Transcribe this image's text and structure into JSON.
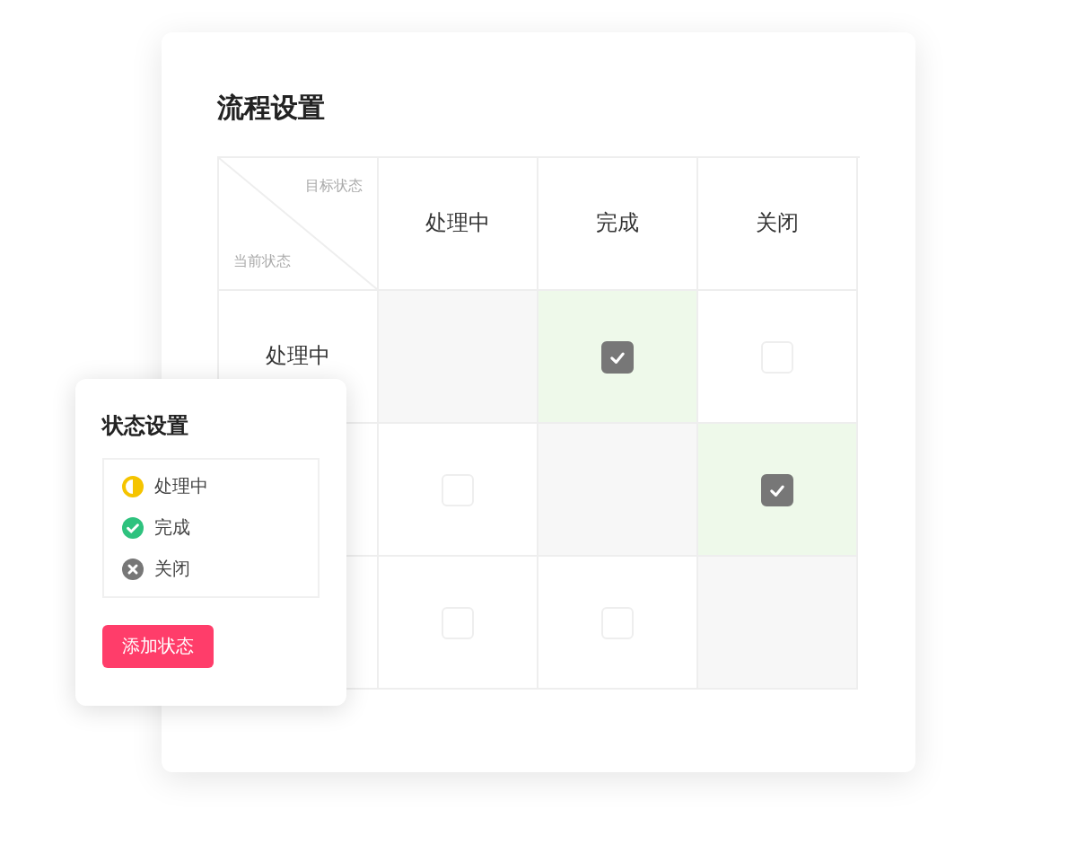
{
  "card": {
    "title": "流程设置"
  },
  "matrix": {
    "corner": {
      "target_label": "目标状态",
      "current_label": "当前状态"
    },
    "columns": [
      "处理中",
      "完成",
      "关闭"
    ],
    "rows": [
      {
        "label": "处理中",
        "cells": [
          {
            "kind": "self"
          },
          {
            "kind": "checkbox",
            "checked": true
          },
          {
            "kind": "checkbox",
            "checked": false
          }
        ]
      },
      {
        "cells": [
          {
            "kind": "checkbox",
            "checked": false
          },
          {
            "kind": "self"
          },
          {
            "kind": "checkbox",
            "checked": true
          }
        ]
      },
      {
        "cells": [
          {
            "kind": "checkbox",
            "checked": false
          },
          {
            "kind": "checkbox",
            "checked": false
          },
          {
            "kind": "self"
          }
        ]
      }
    ]
  },
  "status_panel": {
    "title": "状态设置",
    "statuses": [
      {
        "label": "处理中",
        "kind": "processing"
      },
      {
        "label": "完成",
        "kind": "done"
      },
      {
        "label": "关闭",
        "kind": "closed"
      }
    ],
    "button": "添加状态"
  }
}
